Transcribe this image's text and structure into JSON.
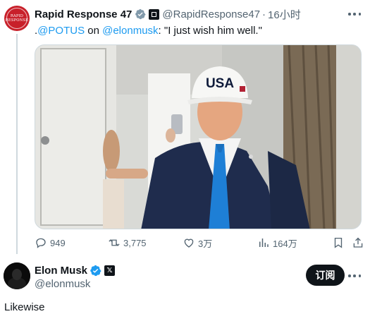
{
  "quoted_post": {
    "avatar_lines": [
      "RAPID",
      "RESPONSE"
    ],
    "author_name": "Rapid Response 47",
    "handle": "@RapidResponse47",
    "separator": "·",
    "time": "16小时",
    "text": {
      "prefix": ".",
      "mention1": "@POTUS",
      "middle": " on ",
      "mention2": "@elonmusk",
      "quote": ": \"I just wish him well.\""
    },
    "media": {
      "cap_text": "USA"
    },
    "actions": {
      "replies": "949",
      "reposts": "3,775",
      "likes": "3万",
      "views": "164万"
    }
  },
  "reply_post": {
    "author_name": "Elon Musk",
    "x_badge": "𝕏",
    "handle": "@elonmusk",
    "subscribe_label": "订阅",
    "text": "Likewise"
  },
  "colors": {
    "accent": "#1d9bf0",
    "text": "#0f1419",
    "muted": "#536471",
    "rapid_red": "#c8202a",
    "tie_blue": "#1e7fd6"
  }
}
